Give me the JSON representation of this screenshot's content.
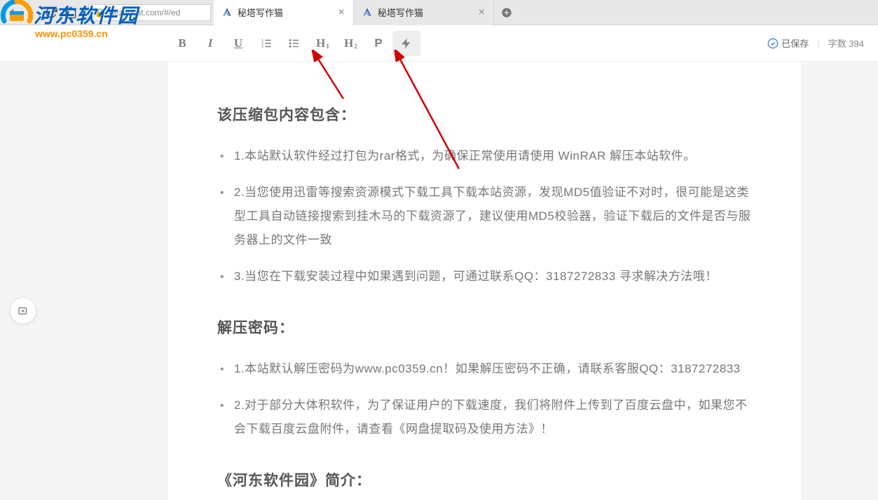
{
  "browser": {
    "url": "xiezuocat.com/#/ed",
    "tabs": [
      {
        "title": "秘塔写作猫",
        "active": true
      },
      {
        "title": "秘塔写作猫",
        "active": false
      }
    ]
  },
  "watermark": {
    "site_name": "河东软件园",
    "site_url": "www.pc0359.cn"
  },
  "toolbar": {
    "bold": "B",
    "italic": "I",
    "underline": "U",
    "h1": "H",
    "h2": "H",
    "p": "P",
    "saved_label": "已保存",
    "word_count_label": "字数 394"
  },
  "document": {
    "sections": [
      {
        "heading": "该压缩包内容包含：",
        "items": [
          "1.本站默认软件经过打包为rar格式，为确保正常使用请使用 WinRAR 解压本站软件。",
          "2.当您使用迅雷等搜索资源模式下载工具下载本站资源，发现MD5值验证不对时，很可能是这类型工具自动链接搜索到挂木马的下载资源了，建议使用MD5校验器，验证下载后的文件是否与服务器上的文件一致",
          "3.当您在下载安装过程中如果遇到问题，可通过联系QQ：3187272833 寻求解决方法哦！"
        ]
      },
      {
        "heading": "解压密码：",
        "items": [
          "1.本站默认解压密码为www.pc0359.cn！如果解压密码不正确，请联系客服QQ：3187272833",
          "2.对于部分大体积软件，为了保证用户的下载速度，我们将附件上传到了百度云盘中，如果您不会下载百度云盘附件，请查看《网盘提取码及使用方法》！"
        ]
      },
      {
        "heading": "《河东软件园》简介：",
        "items": []
      }
    ]
  }
}
